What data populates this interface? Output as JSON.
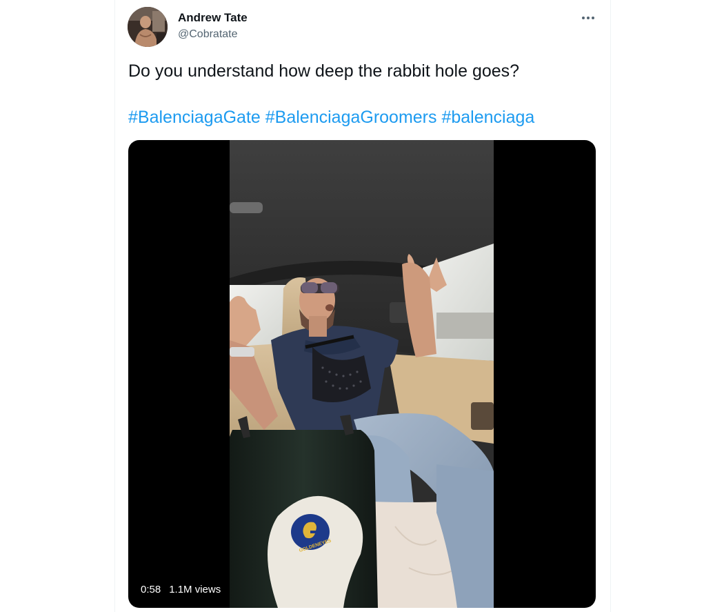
{
  "author": {
    "name": "Andrew Tate",
    "handle": "@Cobratate"
  },
  "tweet": {
    "text": "Do you understand how deep the rabbit hole goes?",
    "hashtags": [
      "#BalenciagaGate",
      "#BalenciagaGroomers",
      "#balenciaga"
    ]
  },
  "video": {
    "duration": "0:58",
    "views": "1.1M views",
    "bag_logo_text": "GOLDENEYES"
  },
  "icons": {
    "more": "more-horizontal-icon"
  },
  "colors": {
    "text": "#0f1419",
    "secondary_text": "#536471",
    "link": "#1d9bf0",
    "video_background": "#000000"
  }
}
